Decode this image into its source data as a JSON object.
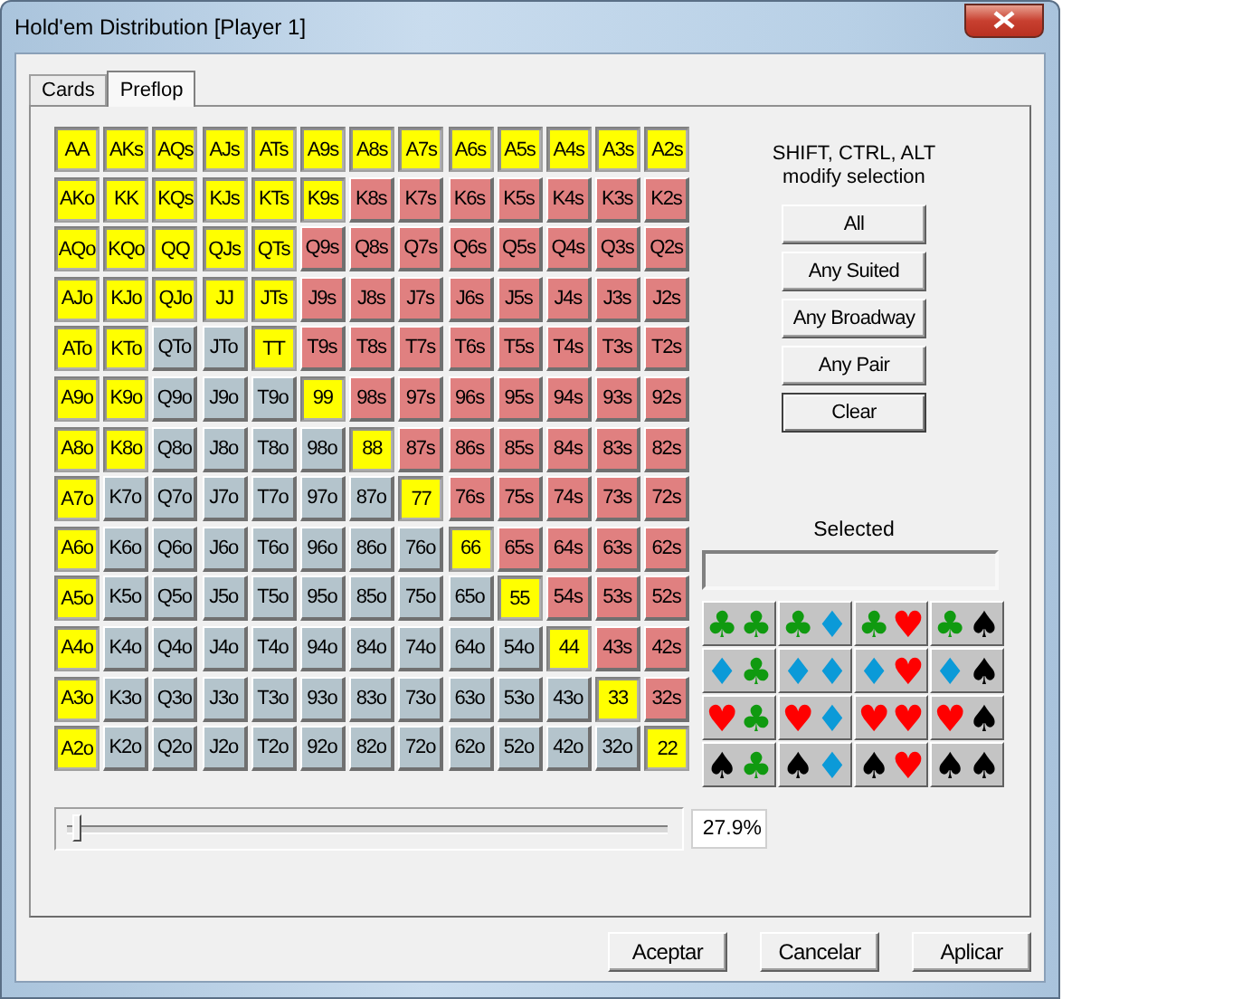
{
  "window": {
    "title": "Hold'em Distribution [Player 1]"
  },
  "tabs": [
    {
      "label": "Cards",
      "selected": false
    },
    {
      "label": "Preflop",
      "selected": true
    }
  ],
  "hand_grid": [
    [
      {
        "label": "AA",
        "selected": true
      },
      {
        "label": "AKs",
        "selected": true
      },
      {
        "label": "AQs",
        "selected": true
      },
      {
        "label": "AJs",
        "selected": true
      },
      {
        "label": "ATs",
        "selected": true
      },
      {
        "label": "A9s",
        "selected": true
      },
      {
        "label": "A8s",
        "selected": true
      },
      {
        "label": "A7s",
        "selected": true
      },
      {
        "label": "A6s",
        "selected": true
      },
      {
        "label": "A5s",
        "selected": true
      },
      {
        "label": "A4s",
        "selected": true
      },
      {
        "label": "A3s",
        "selected": true
      },
      {
        "label": "A2s",
        "selected": true
      }
    ],
    [
      {
        "label": "AKo",
        "selected": true
      },
      {
        "label": "KK",
        "selected": true
      },
      {
        "label": "KQs",
        "selected": true
      },
      {
        "label": "KJs",
        "selected": true
      },
      {
        "label": "KTs",
        "selected": true
      },
      {
        "label": "K9s",
        "selected": true
      },
      {
        "label": "K8s",
        "selected": false
      },
      {
        "label": "K7s",
        "selected": false
      },
      {
        "label": "K6s",
        "selected": false
      },
      {
        "label": "K5s",
        "selected": false
      },
      {
        "label": "K4s",
        "selected": false
      },
      {
        "label": "K3s",
        "selected": false
      },
      {
        "label": "K2s",
        "selected": false
      }
    ],
    [
      {
        "label": "AQo",
        "selected": true
      },
      {
        "label": "KQo",
        "selected": true
      },
      {
        "label": "QQ",
        "selected": true
      },
      {
        "label": "QJs",
        "selected": true
      },
      {
        "label": "QTs",
        "selected": true
      },
      {
        "label": "Q9s",
        "selected": false
      },
      {
        "label": "Q8s",
        "selected": false
      },
      {
        "label": "Q7s",
        "selected": false
      },
      {
        "label": "Q6s",
        "selected": false
      },
      {
        "label": "Q5s",
        "selected": false
      },
      {
        "label": "Q4s",
        "selected": false
      },
      {
        "label": "Q3s",
        "selected": false
      },
      {
        "label": "Q2s",
        "selected": false
      }
    ],
    [
      {
        "label": "AJo",
        "selected": true
      },
      {
        "label": "KJo",
        "selected": true
      },
      {
        "label": "QJo",
        "selected": true
      },
      {
        "label": "JJ",
        "selected": true
      },
      {
        "label": "JTs",
        "selected": true
      },
      {
        "label": "J9s",
        "selected": false
      },
      {
        "label": "J8s",
        "selected": false
      },
      {
        "label": "J7s",
        "selected": false
      },
      {
        "label": "J6s",
        "selected": false
      },
      {
        "label": "J5s",
        "selected": false
      },
      {
        "label": "J4s",
        "selected": false
      },
      {
        "label": "J3s",
        "selected": false
      },
      {
        "label": "J2s",
        "selected": false
      }
    ],
    [
      {
        "label": "ATo",
        "selected": true
      },
      {
        "label": "KTo",
        "selected": true
      },
      {
        "label": "QTo",
        "selected": false
      },
      {
        "label": "JTo",
        "selected": false
      },
      {
        "label": "TT",
        "selected": true
      },
      {
        "label": "T9s",
        "selected": false
      },
      {
        "label": "T8s",
        "selected": false
      },
      {
        "label": "T7s",
        "selected": false
      },
      {
        "label": "T6s",
        "selected": false
      },
      {
        "label": "T5s",
        "selected": false
      },
      {
        "label": "T4s",
        "selected": false
      },
      {
        "label": "T3s",
        "selected": false
      },
      {
        "label": "T2s",
        "selected": false
      }
    ],
    [
      {
        "label": "A9o",
        "selected": true
      },
      {
        "label": "K9o",
        "selected": true
      },
      {
        "label": "Q9o",
        "selected": false
      },
      {
        "label": "J9o",
        "selected": false
      },
      {
        "label": "T9o",
        "selected": false
      },
      {
        "label": "99",
        "selected": true
      },
      {
        "label": "98s",
        "selected": false
      },
      {
        "label": "97s",
        "selected": false
      },
      {
        "label": "96s",
        "selected": false
      },
      {
        "label": "95s",
        "selected": false
      },
      {
        "label": "94s",
        "selected": false
      },
      {
        "label": "93s",
        "selected": false
      },
      {
        "label": "92s",
        "selected": false
      }
    ],
    [
      {
        "label": "A8o",
        "selected": true
      },
      {
        "label": "K8o",
        "selected": true
      },
      {
        "label": "Q8o",
        "selected": false
      },
      {
        "label": "J8o",
        "selected": false
      },
      {
        "label": "T8o",
        "selected": false
      },
      {
        "label": "98o",
        "selected": false
      },
      {
        "label": "88",
        "selected": true
      },
      {
        "label": "87s",
        "selected": false
      },
      {
        "label": "86s",
        "selected": false
      },
      {
        "label": "85s",
        "selected": false
      },
      {
        "label": "84s",
        "selected": false
      },
      {
        "label": "83s",
        "selected": false
      },
      {
        "label": "82s",
        "selected": false
      }
    ],
    [
      {
        "label": "A7o",
        "selected": true
      },
      {
        "label": "K7o",
        "selected": false
      },
      {
        "label": "Q7o",
        "selected": false
      },
      {
        "label": "J7o",
        "selected": false
      },
      {
        "label": "T7o",
        "selected": false
      },
      {
        "label": "97o",
        "selected": false
      },
      {
        "label": "87o",
        "selected": false
      },
      {
        "label": "77",
        "selected": true
      },
      {
        "label": "76s",
        "selected": false
      },
      {
        "label": "75s",
        "selected": false
      },
      {
        "label": "74s",
        "selected": false
      },
      {
        "label": "73s",
        "selected": false
      },
      {
        "label": "72s",
        "selected": false
      }
    ],
    [
      {
        "label": "A6o",
        "selected": true
      },
      {
        "label": "K6o",
        "selected": false
      },
      {
        "label": "Q6o",
        "selected": false
      },
      {
        "label": "J6o",
        "selected": false
      },
      {
        "label": "T6o",
        "selected": false
      },
      {
        "label": "96o",
        "selected": false
      },
      {
        "label": "86o",
        "selected": false
      },
      {
        "label": "76o",
        "selected": false
      },
      {
        "label": "66",
        "selected": true
      },
      {
        "label": "65s",
        "selected": false
      },
      {
        "label": "64s",
        "selected": false
      },
      {
        "label": "63s",
        "selected": false
      },
      {
        "label": "62s",
        "selected": false
      }
    ],
    [
      {
        "label": "A5o",
        "selected": true
      },
      {
        "label": "K5o",
        "selected": false
      },
      {
        "label": "Q5o",
        "selected": false
      },
      {
        "label": "J5o",
        "selected": false
      },
      {
        "label": "T5o",
        "selected": false
      },
      {
        "label": "95o",
        "selected": false
      },
      {
        "label": "85o",
        "selected": false
      },
      {
        "label": "75o",
        "selected": false
      },
      {
        "label": "65o",
        "selected": false
      },
      {
        "label": "55",
        "selected": true
      },
      {
        "label": "54s",
        "selected": false
      },
      {
        "label": "53s",
        "selected": false
      },
      {
        "label": "52s",
        "selected": false
      }
    ],
    [
      {
        "label": "A4o",
        "selected": true
      },
      {
        "label": "K4o",
        "selected": false
      },
      {
        "label": "Q4o",
        "selected": false
      },
      {
        "label": "J4o",
        "selected": false
      },
      {
        "label": "T4o",
        "selected": false
      },
      {
        "label": "94o",
        "selected": false
      },
      {
        "label": "84o",
        "selected": false
      },
      {
        "label": "74o",
        "selected": false
      },
      {
        "label": "64o",
        "selected": false
      },
      {
        "label": "54o",
        "selected": false
      },
      {
        "label": "44",
        "selected": true
      },
      {
        "label": "43s",
        "selected": false
      },
      {
        "label": "42s",
        "selected": false
      }
    ],
    [
      {
        "label": "A3o",
        "selected": true
      },
      {
        "label": "K3o",
        "selected": false
      },
      {
        "label": "Q3o",
        "selected": false
      },
      {
        "label": "J3o",
        "selected": false
      },
      {
        "label": "T3o",
        "selected": false
      },
      {
        "label": "93o",
        "selected": false
      },
      {
        "label": "83o",
        "selected": false
      },
      {
        "label": "73o",
        "selected": false
      },
      {
        "label": "63o",
        "selected": false
      },
      {
        "label": "53o",
        "selected": false
      },
      {
        "label": "43o",
        "selected": false
      },
      {
        "label": "33",
        "selected": true
      },
      {
        "label": "32s",
        "selected": false
      }
    ],
    [
      {
        "label": "A2o",
        "selected": true
      },
      {
        "label": "K2o",
        "selected": false
      },
      {
        "label": "Q2o",
        "selected": false
      },
      {
        "label": "J2o",
        "selected": false
      },
      {
        "label": "T2o",
        "selected": false
      },
      {
        "label": "92o",
        "selected": false
      },
      {
        "label": "82o",
        "selected": false
      },
      {
        "label": "72o",
        "selected": false
      },
      {
        "label": "62o",
        "selected": false
      },
      {
        "label": "52o",
        "selected": false
      },
      {
        "label": "42o",
        "selected": false
      },
      {
        "label": "32o",
        "selected": false
      },
      {
        "label": "22",
        "selected": true
      }
    ]
  ],
  "hint": "SHIFT, CTRL, ALT\nmodify selection",
  "selection_buttons": [
    {
      "label": "All",
      "default": false
    },
    {
      "label": "Any Suited",
      "default": false
    },
    {
      "label": "Any Broadway",
      "default": false
    },
    {
      "label": "Any Pair",
      "default": false
    },
    {
      "label": "Clear",
      "default": true
    }
  ],
  "selected_label": "Selected",
  "suit_combos": [
    [
      [
        {
          "glyph": "♣",
          "color": "#109a10"
        },
        {
          "glyph": "♣",
          "color": "#109a10"
        }
      ],
      [
        {
          "glyph": "♣",
          "color": "#109a10"
        },
        {
          "glyph": "♦",
          "color": "#0b9ad8"
        }
      ],
      [
        {
          "glyph": "♣",
          "color": "#109a10"
        },
        {
          "glyph": "♥",
          "color": "#ff0000"
        }
      ],
      [
        {
          "glyph": "♣",
          "color": "#109a10"
        },
        {
          "glyph": "♠",
          "color": "#000000"
        }
      ]
    ],
    [
      [
        {
          "glyph": "♦",
          "color": "#0b9ad8"
        },
        {
          "glyph": "♣",
          "color": "#109a10"
        }
      ],
      [
        {
          "glyph": "♦",
          "color": "#0b9ad8"
        },
        {
          "glyph": "♦",
          "color": "#0b9ad8"
        }
      ],
      [
        {
          "glyph": "♦",
          "color": "#0b9ad8"
        },
        {
          "glyph": "♥",
          "color": "#ff0000"
        }
      ],
      [
        {
          "glyph": "♦",
          "color": "#0b9ad8"
        },
        {
          "glyph": "♠",
          "color": "#000000"
        }
      ]
    ],
    [
      [
        {
          "glyph": "♥",
          "color": "#ff0000"
        },
        {
          "glyph": "♣",
          "color": "#109a10"
        }
      ],
      [
        {
          "glyph": "♥",
          "color": "#ff0000"
        },
        {
          "glyph": "♦",
          "color": "#0b9ad8"
        }
      ],
      [
        {
          "glyph": "♥",
          "color": "#ff0000"
        },
        {
          "glyph": "♥",
          "color": "#ff0000"
        }
      ],
      [
        {
          "glyph": "♥",
          "color": "#ff0000"
        },
        {
          "glyph": "♠",
          "color": "#000000"
        }
      ]
    ],
    [
      [
        {
          "glyph": "♠",
          "color": "#000000"
        },
        {
          "glyph": "♣",
          "color": "#109a10"
        }
      ],
      [
        {
          "glyph": "♠",
          "color": "#000000"
        },
        {
          "glyph": "♦",
          "color": "#0b9ad8"
        }
      ],
      [
        {
          "glyph": "♠",
          "color": "#000000"
        },
        {
          "glyph": "♥",
          "color": "#ff0000"
        }
      ],
      [
        {
          "glyph": "♠",
          "color": "#000000"
        },
        {
          "glyph": "♠",
          "color": "#000000"
        }
      ]
    ]
  ],
  "range_slider": {
    "level": 0.01
  },
  "range_percent": "27.9%",
  "dialog_buttons": [
    "Aceptar",
    "Cancelar",
    "Aplicar"
  ]
}
